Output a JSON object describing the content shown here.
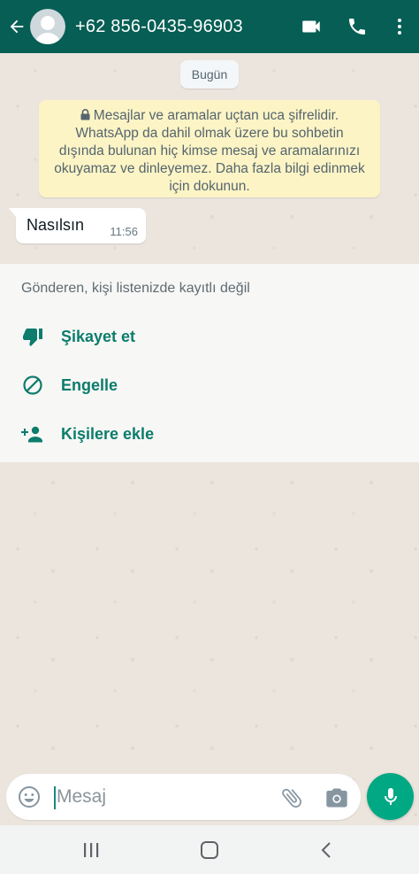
{
  "header": {
    "contact_name": "+62 856-0435-96903",
    "background_color": "#075e54",
    "icons": {
      "back": "arrow-back-icon",
      "avatar": "default-avatar",
      "video_call": "videocam-icon",
      "voice_call": "phone-icon",
      "more": "more-vert-icon"
    }
  },
  "chat": {
    "date_chip": "Bugün",
    "encryption_notice": "Mesajlar ve aramalar uçtan uca şifrelidir. WhatsApp da dahil olmak üzere bu sohbetin dışında bulunan hiç kimse mesaj ve aramalarınızı okuyamaz ve dinleyemez. Daha fazla bilgi edinmek için dokunun.",
    "messages": [
      {
        "direction": "incoming",
        "text": "Nasılsın",
        "time": "11:56"
      }
    ]
  },
  "unknown_sender": {
    "title": "Gönderen, kişi listenizde kayıtlı değil",
    "actions": [
      {
        "label": "Şikayet et",
        "icon": "thumb-down-icon"
      },
      {
        "label": "Engelle",
        "icon": "block-icon"
      },
      {
        "label": "Kişilere ekle",
        "icon": "person-add-icon"
      }
    ],
    "accent_color": "#0c7c6c"
  },
  "composer": {
    "placeholder": "Mesaj",
    "icons": {
      "emoji": "emoji-icon",
      "attach": "paperclip-icon",
      "camera": "camera-icon",
      "mic": "mic-icon"
    },
    "mic_color": "#00a884"
  },
  "navbar": {
    "icons": [
      "recent-apps-icon",
      "home-icon",
      "back-icon"
    ]
  }
}
